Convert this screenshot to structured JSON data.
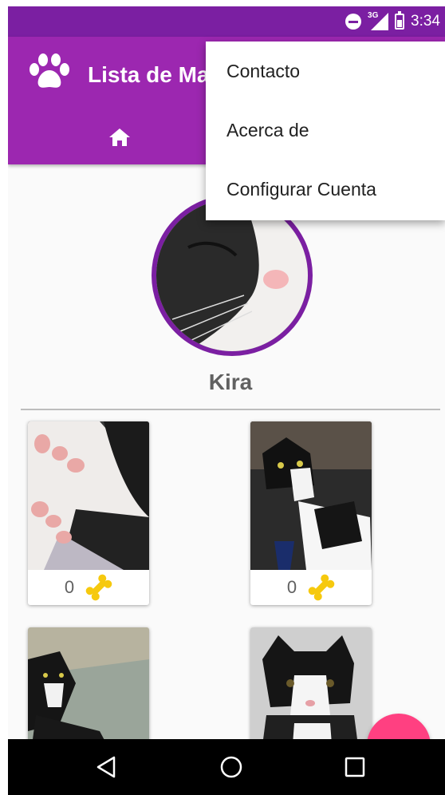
{
  "status_bar": {
    "network": "3G",
    "time": "3:34"
  },
  "app_bar": {
    "title": "Lista de Ma",
    "title_color": "#ffffff",
    "background": "#9c27b0"
  },
  "overflow_menu": {
    "items": [
      {
        "label": "Contacto"
      },
      {
        "label": "Acerca de"
      },
      {
        "label": "Configurar Cuenta"
      }
    ]
  },
  "profile": {
    "name": "Kira",
    "ring_color": "#7b1fa2"
  },
  "photos": [
    {
      "likes": "0",
      "icon": "bone-icon"
    },
    {
      "likes": "0",
      "icon": "bone-icon"
    },
    {
      "likes": "",
      "icon": "bone-icon"
    },
    {
      "likes": "",
      "icon": "bone-icon"
    }
  ],
  "fab": {
    "color": "#ff4081"
  },
  "colors": {
    "primary": "#9c27b0",
    "primary_dark": "#7b1fa2",
    "accent": "#ff4081",
    "bone": "#f6c90e"
  }
}
